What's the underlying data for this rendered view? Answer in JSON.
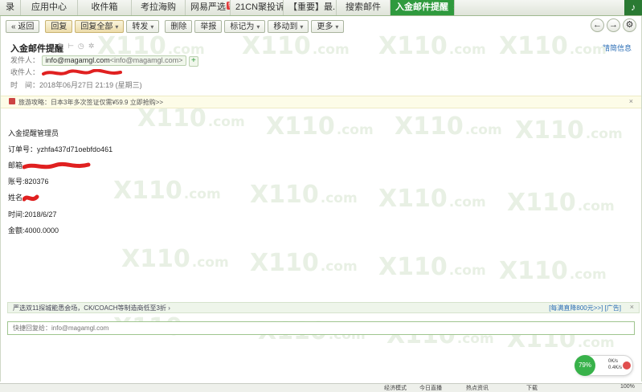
{
  "tabs": [
    {
      "label": "录",
      "width": 26,
      "active": false
    },
    {
      "label": "应用中心",
      "width": 71,
      "active": false
    },
    {
      "label": "收件箱",
      "width": 67,
      "active": false
    },
    {
      "label": "考拉海购",
      "width": 67,
      "active": false
    },
    {
      "label": "网易严选",
      "width": 56,
      "active": false,
      "badge": "特价"
    },
    {
      "label": "21CN聚投诉...",
      "width": 66,
      "active": false
    },
    {
      "label": "【重要】最...",
      "width": 66,
      "active": false
    },
    {
      "label": "搜索邮件",
      "width": 67,
      "active": false
    },
    {
      "label": "入金邮件提醒",
      "width": 80,
      "active": true,
      "close": "×"
    }
  ],
  "toolbar": {
    "back": "返回",
    "reply": "回复",
    "reply_all": "回复全部",
    "forward": "转发",
    "delete": "删除",
    "report": "举报",
    "mark_as": "标记为",
    "move_to": "移动到",
    "more": "更多"
  },
  "mail": {
    "subject": "入金邮件提醒",
    "precise_info": "精简信息",
    "from_label": "发件人：",
    "from_name": "info@magamgl.com",
    "from_addr": "<info@magamgl.com>",
    "to_label": "收件人：",
    "time_label": "时　间：",
    "time_value": "2018年06月27日 21:19 (星期三)"
  },
  "ad": {
    "text": "旅游攻略：日本3年多次签证仅需¥59.9 立即抢购>>"
  },
  "body": {
    "lines": [
      "入金提醒管理员",
      "订单号：yzhfa437d71oebfdo461",
      "邮箱",
      "账号:820376",
      "姓名",
      "时间:2018/6/27",
      "金额:4000.0000"
    ]
  },
  "watermark": {
    "main": "X110",
    "suffix": ".com"
  },
  "promo": {
    "left": "严选双11探城能悉会场，CK/COACH等制造商低至3折 ›",
    "right": "[每满直降800元>>] [广告]",
    "close": "×"
  },
  "reply_box": {
    "placeholder": "快捷回复给：info@magamgl.com"
  },
  "speed": {
    "percent": "79%",
    "up": "0K/s",
    "down": "0.4K/s"
  },
  "status": {
    "items": [
      "经济模式",
      "今日直播",
      "热点资讯",
      "下载",
      "100%"
    ]
  },
  "colors": {
    "accent": "#2f9a3e",
    "link": "#2a6db5",
    "redact": "#e02020"
  }
}
